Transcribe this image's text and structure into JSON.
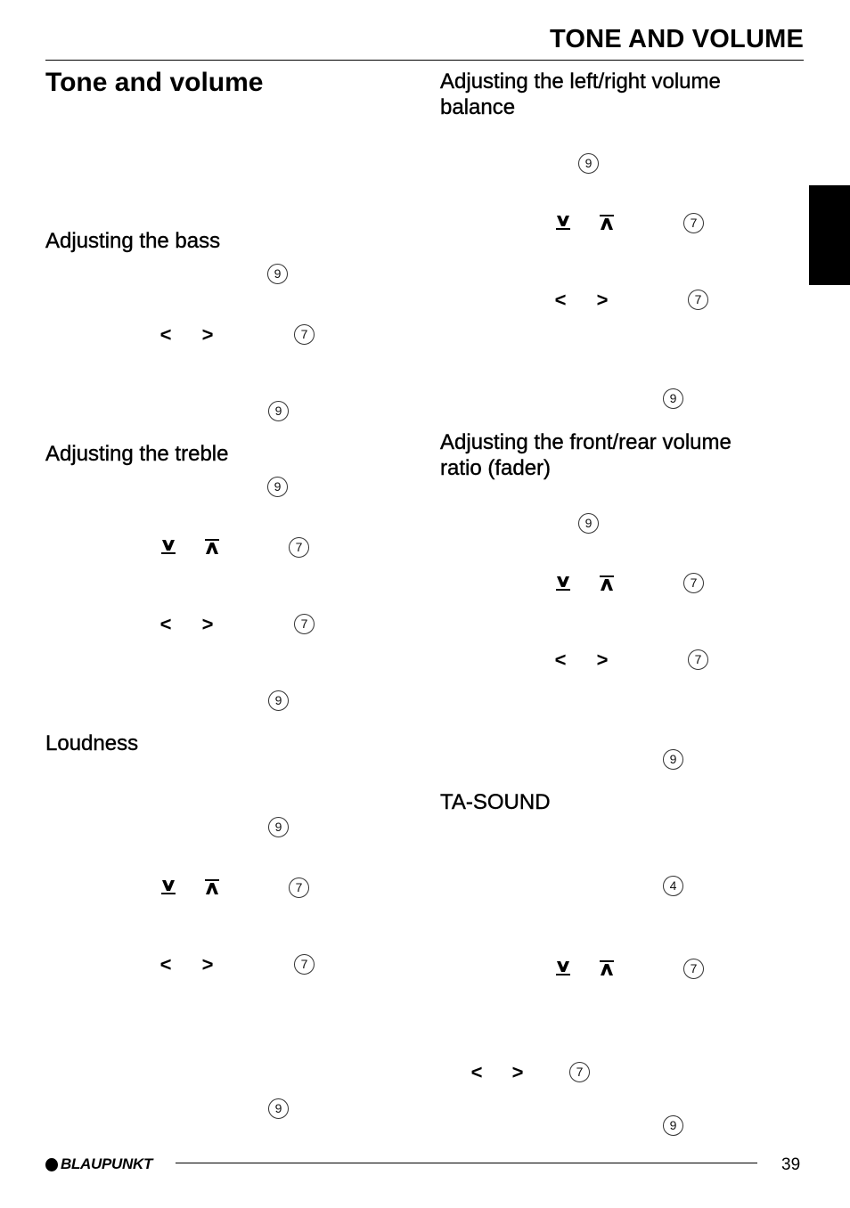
{
  "header": {
    "running_title": "TONE AND VOLUME"
  },
  "left_column": {
    "page_title": "Tone and volume",
    "sections": [
      {
        "heading": "Adjusting the bass"
      },
      {
        "heading": "Adjusting the treble"
      },
      {
        "heading": "Loudness"
      }
    ]
  },
  "right_column": {
    "sections": [
      {
        "heading_line1": "Adjusting the left/right volume",
        "heading_line2": "balance"
      },
      {
        "heading_line1": "Adjusting the front/rear volume",
        "heading_line2": "ratio (fader)"
      },
      {
        "heading": "TA-SOUND"
      }
    ]
  },
  "callouts": {
    "nine": "9",
    "seven": "7",
    "four": "4"
  },
  "keys": {
    "left_arrow": "<",
    "right_arrow": ">",
    "down_arrow": "down-arrow-key",
    "up_arrow": "up-arrow-key"
  },
  "footer": {
    "brand": "BLAUPUNKT",
    "page_number": "39"
  }
}
